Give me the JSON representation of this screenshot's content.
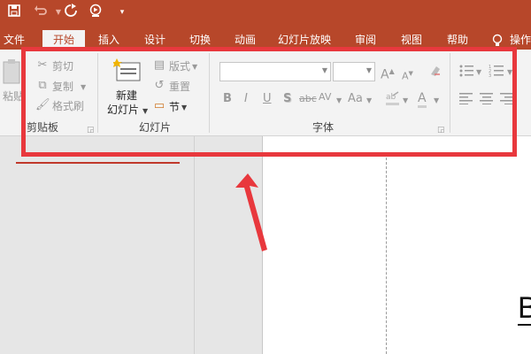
{
  "quick_access": {
    "save_icon": "save-icon",
    "undo_icon": "undo-icon",
    "redo_icon": "redo-icon",
    "present_icon": "start-from-beginning-icon",
    "customize_icon": "customize-quick-access-icon"
  },
  "tabs": [
    "文件",
    "开始",
    "插入",
    "设计",
    "切换",
    "动画",
    "幻灯片放映",
    "审阅",
    "视图",
    "帮助"
  ],
  "active_tab": "开始",
  "tell_me_label": "操作",
  "clipboard": {
    "paste_label": "粘贴",
    "cut_label": "剪切",
    "copy_label": "复制",
    "format_painter_label": "格式刷",
    "group_label": "剪贴板"
  },
  "slides": {
    "new_slide_label_1": "新建",
    "new_slide_label_2": "幻灯片",
    "layout_label": "版式",
    "reset_label": "重置",
    "section_label": "节",
    "group_label": "幻灯片"
  },
  "font": {
    "font_name_value": "",
    "font_size_value": "",
    "bold": "B",
    "italic": "I",
    "underline": "U",
    "shadow": "S",
    "strikethrough": "abc",
    "spacing": "AV",
    "case": "Aa",
    "color": "A",
    "grow": "A",
    "shrink": "A",
    "group_label": "字体"
  },
  "slide_text": "B",
  "colors": {
    "title_bar": "#b7472a",
    "ribbon": "#f3f3f3",
    "highlight": "#e8383d"
  }
}
